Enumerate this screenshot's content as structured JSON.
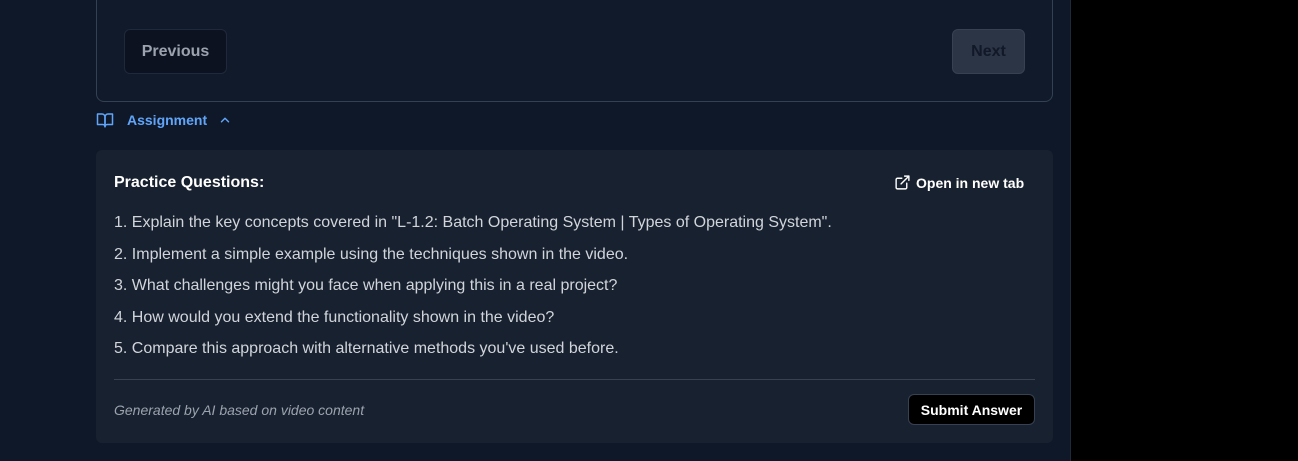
{
  "navigation": {
    "previous_label": "Previous",
    "next_label": "Next"
  },
  "assignment": {
    "toggle_label": "Assignment",
    "toggle_icon": "book-open-icon",
    "chevron_icon": "chevron-up-icon",
    "panel_title": "Practice Questions:",
    "open_tab_label": "Open in new tab",
    "open_tab_icon": "external-link-icon",
    "questions": [
      "1. Explain the key concepts covered in \"L-1.2: Batch Operating System | Types of Operating System\".",
      "2. Implement a simple example using the techniques shown in the video.",
      "3. What challenges might you face when applying this in a real project?",
      "4. How would you extend the functionality shown in the video?",
      "5. Compare this approach with alternative methods you've used before."
    ],
    "footnote": "Generated by AI based on video content",
    "submit_label": "Submit Answer"
  },
  "colors": {
    "accent": "#60a5fa",
    "background": "#0f1828",
    "panel": "#18212f"
  }
}
